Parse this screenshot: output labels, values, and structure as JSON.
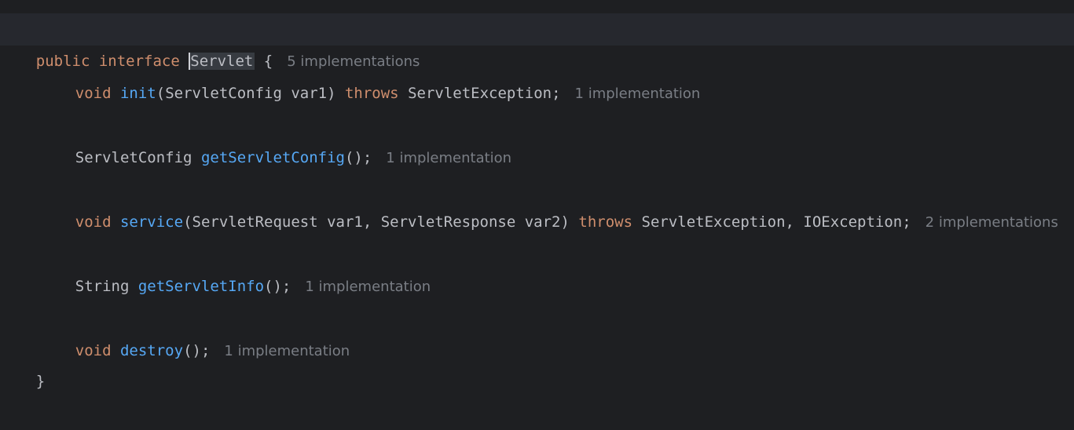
{
  "code": {
    "line1": {
      "kw_public": "public",
      "kw_interface": "interface",
      "name": "Servlet",
      "brace": "{",
      "hint": "5 implementations"
    },
    "line2": {
      "type": "void",
      "method": "init",
      "params": "(ServletConfig var1)",
      "throws": "throws",
      "exceptions": "ServletException;",
      "hint": "1 implementation"
    },
    "line3": {
      "type": "ServletConfig",
      "method": "getServletConfig",
      "params": "();",
      "hint": "1 implementation"
    },
    "line4": {
      "type": "void",
      "method": "service",
      "params": "(ServletRequest var1, ServletResponse var2)",
      "throws": "throws",
      "exceptions": "ServletException, IOException;",
      "hint": "2 implementations"
    },
    "line5": {
      "type": "String",
      "method": "getServletInfo",
      "params": "();",
      "hint": "1 implementation"
    },
    "line6": {
      "type": "void",
      "method": "destroy",
      "params": "();",
      "hint": "1 implementation"
    },
    "line7": {
      "brace": "}"
    }
  },
  "colors": {
    "background": "#1e1f22",
    "keyword": "#cf8e6d",
    "method": "#56a8f5",
    "text": "#bcbec4",
    "hint": "#7a7e85"
  }
}
